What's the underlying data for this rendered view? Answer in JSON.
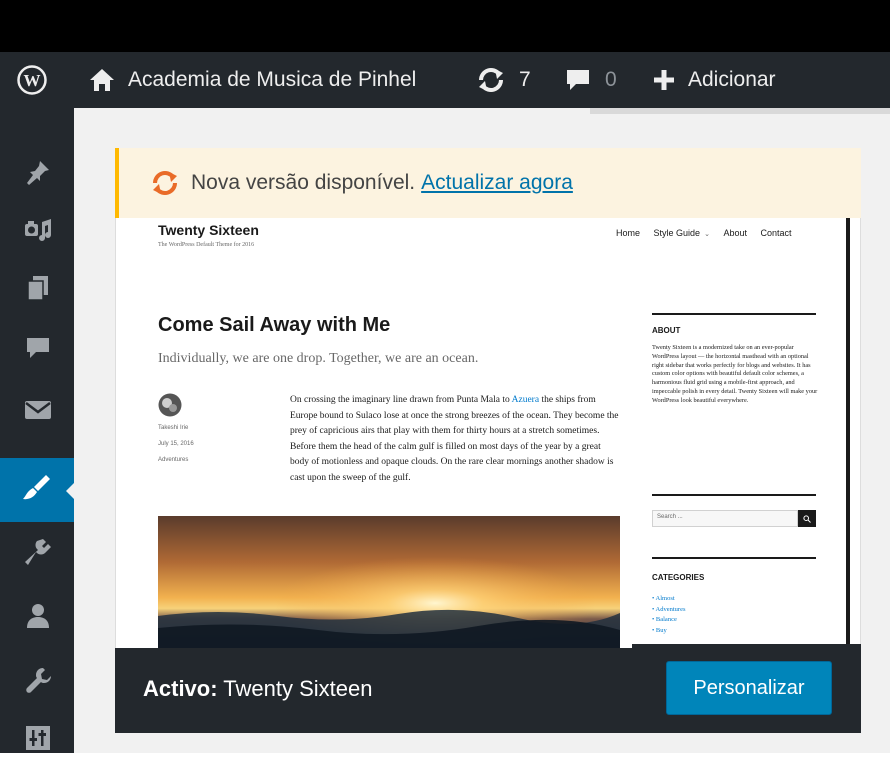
{
  "admin_bar": {
    "site_name": "Academia de Musica de Pinhel",
    "updates_count": "7",
    "comments_count": "0",
    "new_label": "Adicionar"
  },
  "notice": {
    "text": "Nova versão disponível.",
    "link": "Actualizar agora"
  },
  "preview": {
    "site_title": "Twenty Sixteen",
    "tagline": "The WordPress Default Theme for 2016",
    "menu": [
      "Home",
      "Style Guide",
      "About",
      "Contact"
    ],
    "post_title": "Come Sail Away with Me",
    "post_subtitle": "Individually, we are one drop. Together, we are an ocean.",
    "author": "Takeshi Irie",
    "date": "July 15, 2016",
    "category": "Adventures",
    "body_before_link": "On crossing the imaginary line drawn from Punta Mala to ",
    "body_link": "Azuera",
    "body_after_link": " the ships from Europe bound to Sulaco lose at once the strong breezes of the ocean. They become the prey of capricious airs that play with them for thirty hours at a stretch sometimes. Before them the head of the calm gulf is filled on most days of the year by a great body of motionless and opaque clouds. On the rare clear mornings another shadow is cast upon the sweep of the gulf.",
    "about_heading": "ABOUT",
    "about_text": "Twenty Sixteen is a modernized take on an ever-popular WordPress layout — the horizontal masthead with an optional right sidebar that works perfectly for blogs and websites. It has custom color options with beautiful default color schemes, a harmonious fluid grid using a mobile-first approach, and impeccable polish in every detail. Twenty Sixteen will make your WordPress look beautiful everywhere.",
    "search_placeholder": "Search ...",
    "categories_heading": "CATEGORIES",
    "categories": [
      "Almost",
      "Adventures",
      "Balance",
      "Buy"
    ]
  },
  "footer": {
    "active_label": "Activo:",
    "theme_name": "Twenty Sixteen",
    "customize_button": "Personalizar"
  },
  "colors": {
    "admin_bar_bg": "#23282d",
    "accent_blue": "#0073aa",
    "notice_border": "#ffb900",
    "update_icon": "#e96b28"
  }
}
